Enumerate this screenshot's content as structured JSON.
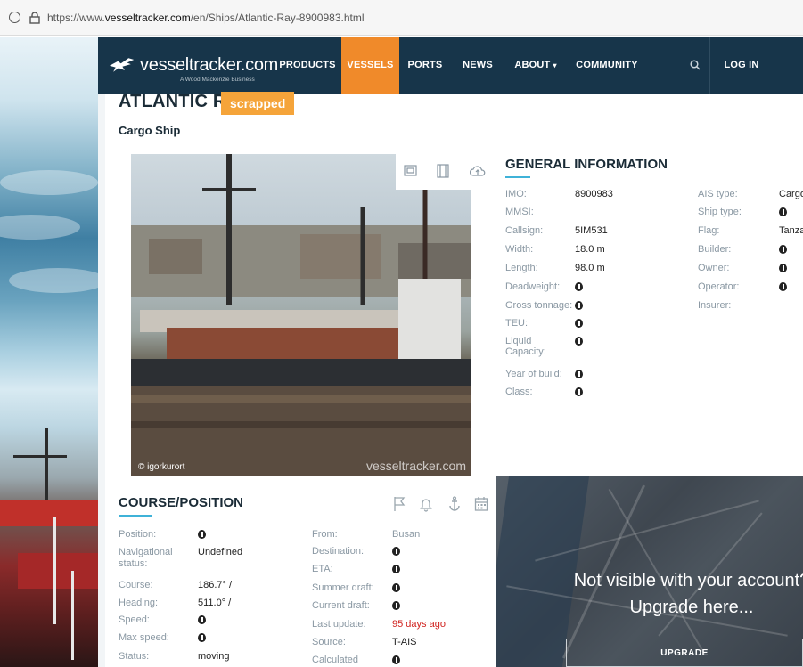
{
  "browser": {
    "url_prefix": "https://www.",
    "url_domain": "vesseltracker.com",
    "url_path": "/en/Ships/Atlantic-Ray-8900983.html"
  },
  "navbar": {
    "logo_name": "vesseltracker.com",
    "logo_tagline": "A Wood Mackenzie Business",
    "items": [
      "PRODUCTS",
      "VESSELS",
      "PORTS",
      "NEWS",
      "ABOUT",
      "COMMUNITY"
    ],
    "login": "LOG IN",
    "active": "VESSELS",
    "bg_color": "#17354a",
    "accent_color": "#f08a2a"
  },
  "ship": {
    "name": "ATLANTIC RAY",
    "status_badge": "scrapped",
    "type": "Cargo Ship"
  },
  "photo": {
    "credit": "© igorkurort",
    "watermark": "vesseltracker.com"
  },
  "general": {
    "title": "GENERAL INFORMATION",
    "left": [
      {
        "label": "IMO:",
        "value": "8900983"
      },
      {
        "label": "MMSI:",
        "value": ""
      },
      {
        "label": "Callsign:",
        "value": "5IM531"
      },
      {
        "label": "Width:",
        "value": "18.0 m"
      },
      {
        "label": "Length:",
        "value": "98.0 m"
      },
      {
        "label": "Deadweight:",
        "value": "info-icon"
      },
      {
        "label": "Gross tonnage:",
        "value": "info-icon"
      },
      {
        "label": "TEU:",
        "value": "info-icon"
      },
      {
        "label": "Liquid Capacity:",
        "value": "info-icon"
      },
      {
        "label": "Year of build:",
        "value": "info-icon"
      },
      {
        "label": "Class:",
        "value": "info-icon"
      }
    ],
    "right": [
      {
        "label": "AIS type:",
        "value": "Cargo"
      },
      {
        "label": "Ship type:",
        "value": "info-icon"
      },
      {
        "label": "Flag:",
        "value": "Tanza"
      },
      {
        "label": "Builder:",
        "value": "info-icon"
      },
      {
        "label": "Owner:",
        "value": "info-icon"
      },
      {
        "label": "Operator:",
        "value": "info-icon"
      },
      {
        "label": "Insurer:",
        "value": ""
      }
    ]
  },
  "course": {
    "title": "COURSE/POSITION",
    "left": [
      {
        "label": "Position:",
        "value": "info-icon"
      },
      {
        "label": "Navigational status:",
        "value": "Undefined"
      },
      {
        "label": "Course:",
        "value": "186.7° /"
      },
      {
        "label": "Heading:",
        "value": "511.0° /"
      },
      {
        "label": "Speed:",
        "value": "info-icon"
      },
      {
        "label": "Max speed:",
        "value": "info-icon"
      },
      {
        "label": "Status:",
        "value": "moving"
      }
    ],
    "right": [
      {
        "label": "From:",
        "value": "Busan"
      },
      {
        "label": "Destination:",
        "value": "info-icon"
      },
      {
        "label": "ETA:",
        "value": "info-icon"
      },
      {
        "label": "Summer draft:",
        "value": "info-icon"
      },
      {
        "label": "Current draft:",
        "value": "info-icon"
      },
      {
        "label": "Last update:",
        "value": "95 days ago"
      },
      {
        "label": "Source:",
        "value": "T-AIS"
      },
      {
        "label": "Calculated",
        "value": "info-icon"
      }
    ]
  },
  "map": {
    "message_line1": "Not visible with your account?",
    "message_line2": "Upgrade here...",
    "upgrade_label": "UPGRADE"
  }
}
